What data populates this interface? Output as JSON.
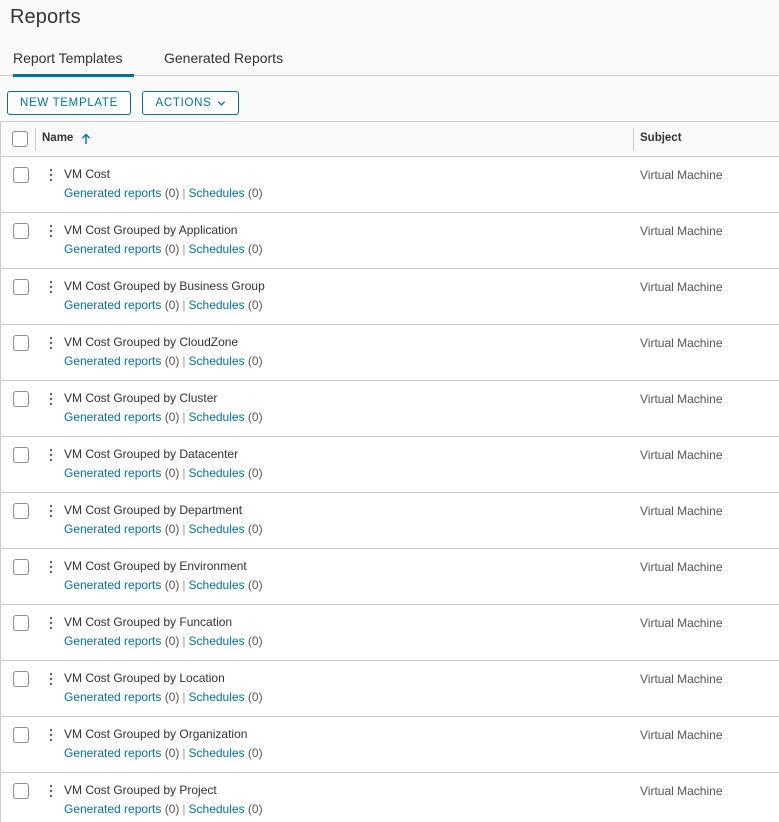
{
  "page": {
    "title": "Reports"
  },
  "tabs": [
    {
      "label": "Report Templates",
      "active": true
    },
    {
      "label": "Generated Reports",
      "active": false
    }
  ],
  "toolbar": {
    "new_label": "NEW TEMPLATE",
    "actions_label": "ACTIONS"
  },
  "table": {
    "columns": {
      "name": "Name",
      "subject": "Subject"
    },
    "sort": {
      "column": "Name",
      "direction": "ascending"
    },
    "rows": [
      {
        "name": "VM Cost",
        "generated_label": "Generated reports",
        "generated_count": "(0)",
        "divider": "|",
        "schedules_label": "Schedules",
        "schedules_count": "(0)",
        "subject": "Virtual Machine"
      },
      {
        "name": "VM Cost Grouped by Application",
        "generated_label": "Generated reports",
        "generated_count": "(0)",
        "divider": "|",
        "schedules_label": "Schedules",
        "schedules_count": "(0)",
        "subject": "Virtual Machine"
      },
      {
        "name": "VM Cost Grouped by Business Group",
        "generated_label": "Generated reports",
        "generated_count": "(0)",
        "divider": "|",
        "schedules_label": "Schedules",
        "schedules_count": "(0)",
        "subject": "Virtual Machine"
      },
      {
        "name": "VM Cost Grouped by CloudZone",
        "generated_label": "Generated reports",
        "generated_count": "(0)",
        "divider": "|",
        "schedules_label": "Schedules",
        "schedules_count": "(0)",
        "subject": "Virtual Machine"
      },
      {
        "name": "VM Cost Grouped by Cluster",
        "generated_label": "Generated reports",
        "generated_count": "(0)",
        "divider": "|",
        "schedules_label": "Schedules",
        "schedules_count": "(0)",
        "subject": "Virtual Machine"
      },
      {
        "name": "VM Cost Grouped by Datacenter",
        "generated_label": "Generated reports",
        "generated_count": "(0)",
        "divider": "|",
        "schedules_label": "Schedules",
        "schedules_count": "(0)",
        "subject": "Virtual Machine"
      },
      {
        "name": "VM Cost Grouped by Department",
        "generated_label": "Generated reports",
        "generated_count": "(0)",
        "divider": "|",
        "schedules_label": "Schedules",
        "schedules_count": "(0)",
        "subject": "Virtual Machine"
      },
      {
        "name": "VM Cost Grouped by Environment",
        "generated_label": "Generated reports",
        "generated_count": "(0)",
        "divider": "|",
        "schedules_label": "Schedules",
        "schedules_count": "(0)",
        "subject": "Virtual Machine"
      },
      {
        "name": "VM Cost Grouped by Funcation",
        "generated_label": "Generated reports",
        "generated_count": "(0)",
        "divider": "|",
        "schedules_label": "Schedules",
        "schedules_count": "(0)",
        "subject": "Virtual Machine"
      },
      {
        "name": "VM Cost Grouped by Location",
        "generated_label": "Generated reports",
        "generated_count": "(0)",
        "divider": "|",
        "schedules_label": "Schedules",
        "schedules_count": "(0)",
        "subject": "Virtual Machine"
      },
      {
        "name": "VM Cost Grouped by Organization",
        "generated_label": "Generated reports",
        "generated_count": "(0)",
        "divider": "|",
        "schedules_label": "Schedules",
        "schedules_count": "(0)",
        "subject": "Virtual Machine"
      },
      {
        "name": "VM Cost Grouped by Project",
        "generated_label": "Generated reports",
        "generated_count": "(0)",
        "divider": "|",
        "schedules_label": "Schedules",
        "schedules_count": "(0)",
        "subject": "Virtual Machine"
      }
    ]
  },
  "colors": {
    "accent": "#0072a3",
    "border": "#cccccc",
    "text": "#333333"
  },
  "icons": {
    "sort": "arrow-up-icon",
    "actions_caret": "chevron-down-icon",
    "row_menu": "kebab-icon"
  }
}
